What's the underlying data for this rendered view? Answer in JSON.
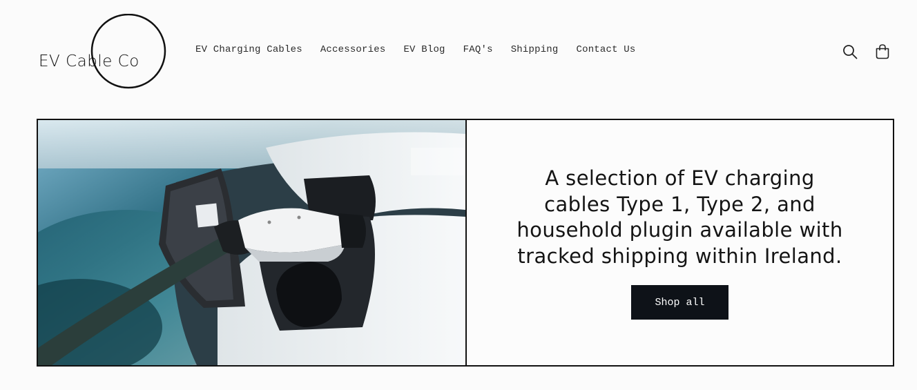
{
  "brand": {
    "logo_text": "EV Cable Co"
  },
  "nav": {
    "items": [
      {
        "label": "EV Charging Cables"
      },
      {
        "label": "Accessories"
      },
      {
        "label": "EV Blog"
      },
      {
        "label": "FAQ's"
      },
      {
        "label": "Shipping"
      },
      {
        "label": "Contact Us"
      }
    ]
  },
  "header_icons": {
    "search": "search-icon",
    "cart": "cart-icon"
  },
  "hero": {
    "heading": "A selection of EV charging cables Type 1, Type 2, and household plugin available with tracked shipping within Ireland.",
    "button_label": "Shop all",
    "image": "ev-charging-plug-photo"
  },
  "colors": {
    "background": "#fbfbfb",
    "text": "#121212",
    "button_bg": "#0e1218",
    "button_text": "#ffffff",
    "border": "#111111"
  }
}
